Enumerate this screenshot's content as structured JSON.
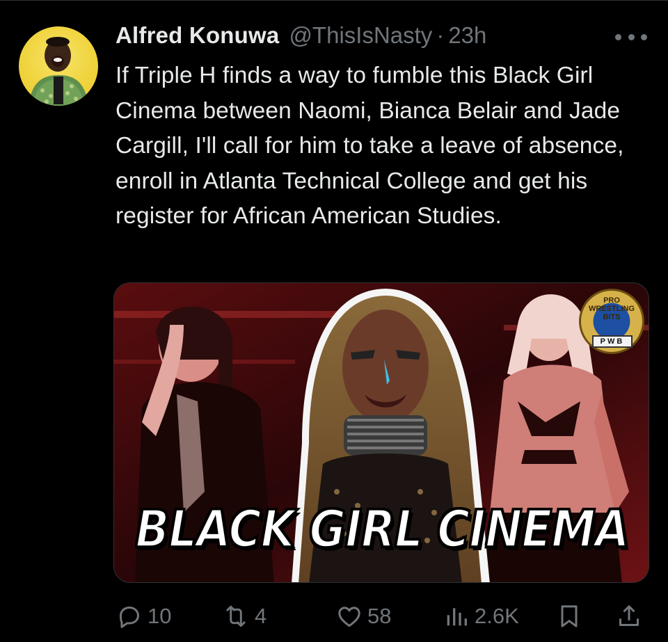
{
  "tweet": {
    "author_name": "Alfred Konuwa",
    "handle": "@ThisIsNasty",
    "separator": "·",
    "time": "23h",
    "text": "If Triple H finds a way to fumble this Black Girl Cinema between Naomi, Bianca Belair and Jade Cargill, I'll call for him to take a leave of absence, enroll in Atlanta Technical College and get his register for African American Studies."
  },
  "media": {
    "caption": "BLACK GIRL CINEMA",
    "badge_top": "PRO WRESTLING BITS",
    "badge_bottom": "PWB"
  },
  "actions": {
    "replies": "10",
    "reposts": "4",
    "likes": "58",
    "views": "2.6K"
  },
  "icons": {
    "more": "more-horizontal-icon",
    "reply": "reply-icon",
    "repost": "repost-icon",
    "like": "heart-icon",
    "views": "views-icon",
    "bookmark": "bookmark-icon",
    "share": "share-icon"
  },
  "colors": {
    "background": "#000000",
    "text_primary": "#e7e9ea",
    "text_secondary": "#71767b",
    "avatar_bg": "#f0d43e"
  }
}
